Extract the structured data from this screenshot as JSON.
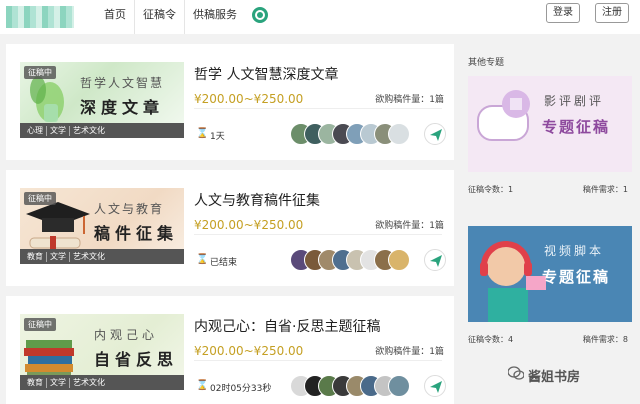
{
  "header": {
    "nav": [
      "首页",
      "征稿令",
      "供稿服务"
    ],
    "login": "登录",
    "register": "注册"
  },
  "cards": [
    {
      "badge": "征稿中",
      "image_line1": "哲学人文智慧",
      "image_line2": "深度文章",
      "tags": [
        "心理",
        "文学",
        "艺术文化"
      ],
      "title": "哲学 人文智慧深度文章",
      "price": "¥200.00~¥250.00",
      "quantity": "欲购稿件量：1篇",
      "status": "1天"
    },
    {
      "badge": "征稿中",
      "image_line1": "人文与教育",
      "image_line2": "稿件征集",
      "tags": [
        "教育",
        "文学",
        "艺术文化"
      ],
      "title": "人文与教育稿件征集",
      "price": "¥200.00~¥250.00",
      "quantity": "欲购稿件量：1篇",
      "status": "已结束"
    },
    {
      "badge": "征稿中",
      "image_line1": "内观己心",
      "image_line2": "自省反思",
      "tags": [
        "教育",
        "文学",
        "艺术文化"
      ],
      "title": "内观己心：自省·反思主题征稿",
      "price": "¥200.00~¥250.00",
      "quantity": "欲购稿件量：1篇",
      "status": "02时05分33秒"
    }
  ],
  "sidebar": {
    "title": "其他专题",
    "topics": [
      {
        "line1": "影评剧评",
        "line2": "专题征稿",
        "count": "征稿令数：1",
        "demand": "稿件需求：1"
      },
      {
        "line1": "视频脚本",
        "line2": "专题征稿",
        "count": "征稿令数：4",
        "demand": "稿件需求：8"
      }
    ]
  },
  "watermark": "酱姐书房",
  "colors": {
    "accent": "#2aa37d",
    "price": "#c5a024",
    "tagbar": "#555555"
  }
}
